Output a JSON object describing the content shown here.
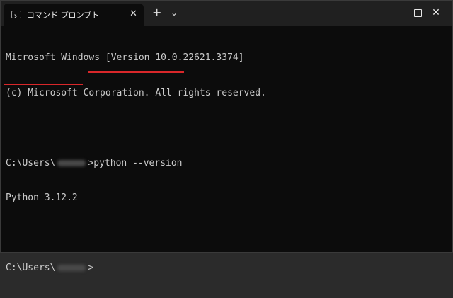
{
  "window": {
    "tab_title": "コマンド プロンプト",
    "tab_close": "✕",
    "new_tab": "+",
    "dropdown": "⌄",
    "minimize": "—",
    "maximize": "☐",
    "close": "✕"
  },
  "console": {
    "lines": [
      "Microsoft Windows [Version 10.0.22621.3374]",
      "(c) Microsoft Corporation. All rights reserved."
    ],
    "prompt_prefix": "C:\\Users\\",
    "prompt_suffix": ">",
    "command": "python --version",
    "output": "Python 3.12.2"
  },
  "colors": {
    "background": "#0c0c0c",
    "titlebar": "#202020",
    "text": "#cccccc",
    "highlight_underline": "#d9272a"
  },
  "icons": [
    "terminal-icon",
    "close-icon",
    "plus-icon",
    "chevron-down-icon",
    "minimize-icon",
    "maximize-icon",
    "close-icon"
  ]
}
